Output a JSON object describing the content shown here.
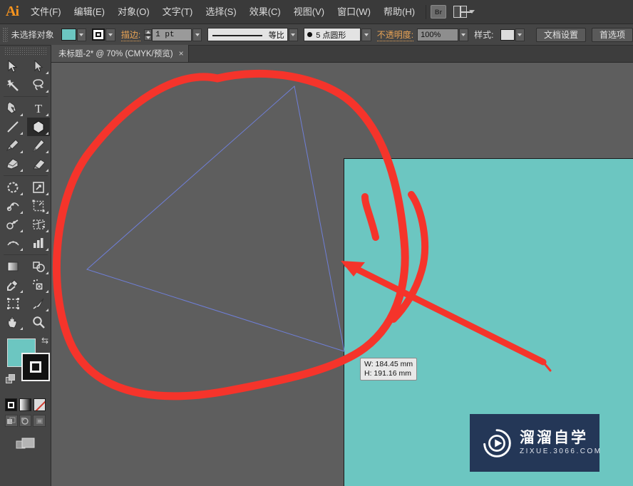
{
  "app": {
    "logo": "Ai"
  },
  "menubar": {
    "items": [
      {
        "label": "文件(F)",
        "name": "menu-file"
      },
      {
        "label": "编辑(E)",
        "name": "menu-edit"
      },
      {
        "label": "对象(O)",
        "name": "menu-object"
      },
      {
        "label": "文字(T)",
        "name": "menu-type"
      },
      {
        "label": "选择(S)",
        "name": "menu-select"
      },
      {
        "label": "效果(C)",
        "name": "menu-effect"
      },
      {
        "label": "视图(V)",
        "name": "menu-view"
      },
      {
        "label": "窗口(W)",
        "name": "menu-window"
      },
      {
        "label": "帮助(H)",
        "name": "menu-help"
      }
    ],
    "bridge_label": "Br",
    "workspace_icon": "layout-switcher-icon"
  },
  "controlbar": {
    "selection_status": "未选择对象",
    "fill_swatch_color": "#6cc6c1",
    "stroke_label": "描边:",
    "stroke_weight": "1 pt",
    "stroke_profile": "等比",
    "brush_definition": "5 点圆形",
    "opacity_label": "不透明度:",
    "opacity_value": "100%",
    "style_label": "样式:",
    "document_setup": "文档设置",
    "preferences": "首选项"
  },
  "tabbar": {
    "document_title": "未标题-2* @ 70% (CMYK/预览)",
    "close_glyph": "×"
  },
  "toolpanel": {
    "tools": [
      {
        "name": "selection-tool",
        "icon": "arrow-solid"
      },
      {
        "name": "direct-selection-tool",
        "icon": "arrow-outline"
      },
      {
        "name": "magic-wand-tool",
        "icon": "magic-wand"
      },
      {
        "name": "lasso-tool",
        "icon": "lasso"
      },
      {
        "name": "pen-tool",
        "icon": "pen-nib"
      },
      {
        "name": "type-tool",
        "icon": "type-t"
      },
      {
        "name": "line-segment-tool",
        "icon": "line-diagonal"
      },
      {
        "name": "shape-tool",
        "icon": "polygon",
        "selected": true
      },
      {
        "name": "paintbrush-tool",
        "icon": "paintbrush"
      },
      {
        "name": "pencil-tool",
        "icon": "pencil"
      },
      {
        "name": "blob-brush-tool",
        "icon": "blob-brush"
      },
      {
        "name": "eraser-tool",
        "icon": "eraser"
      },
      {
        "name": "rotate-tool",
        "icon": "rotate"
      },
      {
        "name": "scale-tool",
        "icon": "scale-arrow"
      },
      {
        "name": "width-tool",
        "icon": "width-warp"
      },
      {
        "name": "free-transform-tool",
        "icon": "free-transform"
      },
      {
        "name": "shape-builder-tool",
        "icon": "shape-builder"
      },
      {
        "name": "perspective-grid-tool",
        "icon": "perspective-grid"
      },
      {
        "name": "mesh-tool",
        "icon": "mesh"
      },
      {
        "name": "gradient-tool",
        "icon": "gradient"
      },
      {
        "name": "eyedropper-tool",
        "icon": "eyedropper"
      },
      {
        "name": "blend-tool",
        "icon": "blend"
      },
      {
        "name": "symbol-sprayer-tool",
        "icon": "symbol-sprayer"
      },
      {
        "name": "column-graph-tool",
        "icon": "bar-graph"
      },
      {
        "name": "artboard-tool",
        "icon": "artboard"
      },
      {
        "name": "slice-tool",
        "icon": "slice-knife"
      },
      {
        "name": "hand-tool",
        "icon": "hand"
      },
      {
        "name": "zoom-tool",
        "icon": "magnifier"
      }
    ],
    "fill_color": "#6cc6c1",
    "stroke_color": "#111111",
    "swap_glyph": "⇆",
    "swatch_modes": [
      {
        "name": "color-swatch-button",
        "icon": "solid-color"
      },
      {
        "name": "gradient-swatch-button",
        "icon": "gradient"
      },
      {
        "name": "none-swatch-button",
        "icon": "no-color"
      }
    ],
    "screen_modes": [
      {
        "name": "drawing-mode-normal",
        "icon": "draw-normal"
      },
      {
        "name": "drawing-mode-behind",
        "icon": "draw-behind"
      },
      {
        "name": "drawing-mode-inside",
        "icon": "draw-inside"
      }
    ],
    "screen_mode_icon": "screen-mode-icon"
  },
  "canvas": {
    "artboard_color": "#6cc6c1",
    "background_color": "#5e5e5e",
    "path_stroke_color": "#6f7fd8",
    "annotation_color": "#f5342b",
    "tooltip": {
      "width_text": "W: 184.45 mm",
      "height_text": "H: 191.16 mm"
    },
    "watermark": {
      "title": "溜溜自学",
      "subtitle": "ZIXUE.3066.COM",
      "background": "#243757"
    }
  }
}
